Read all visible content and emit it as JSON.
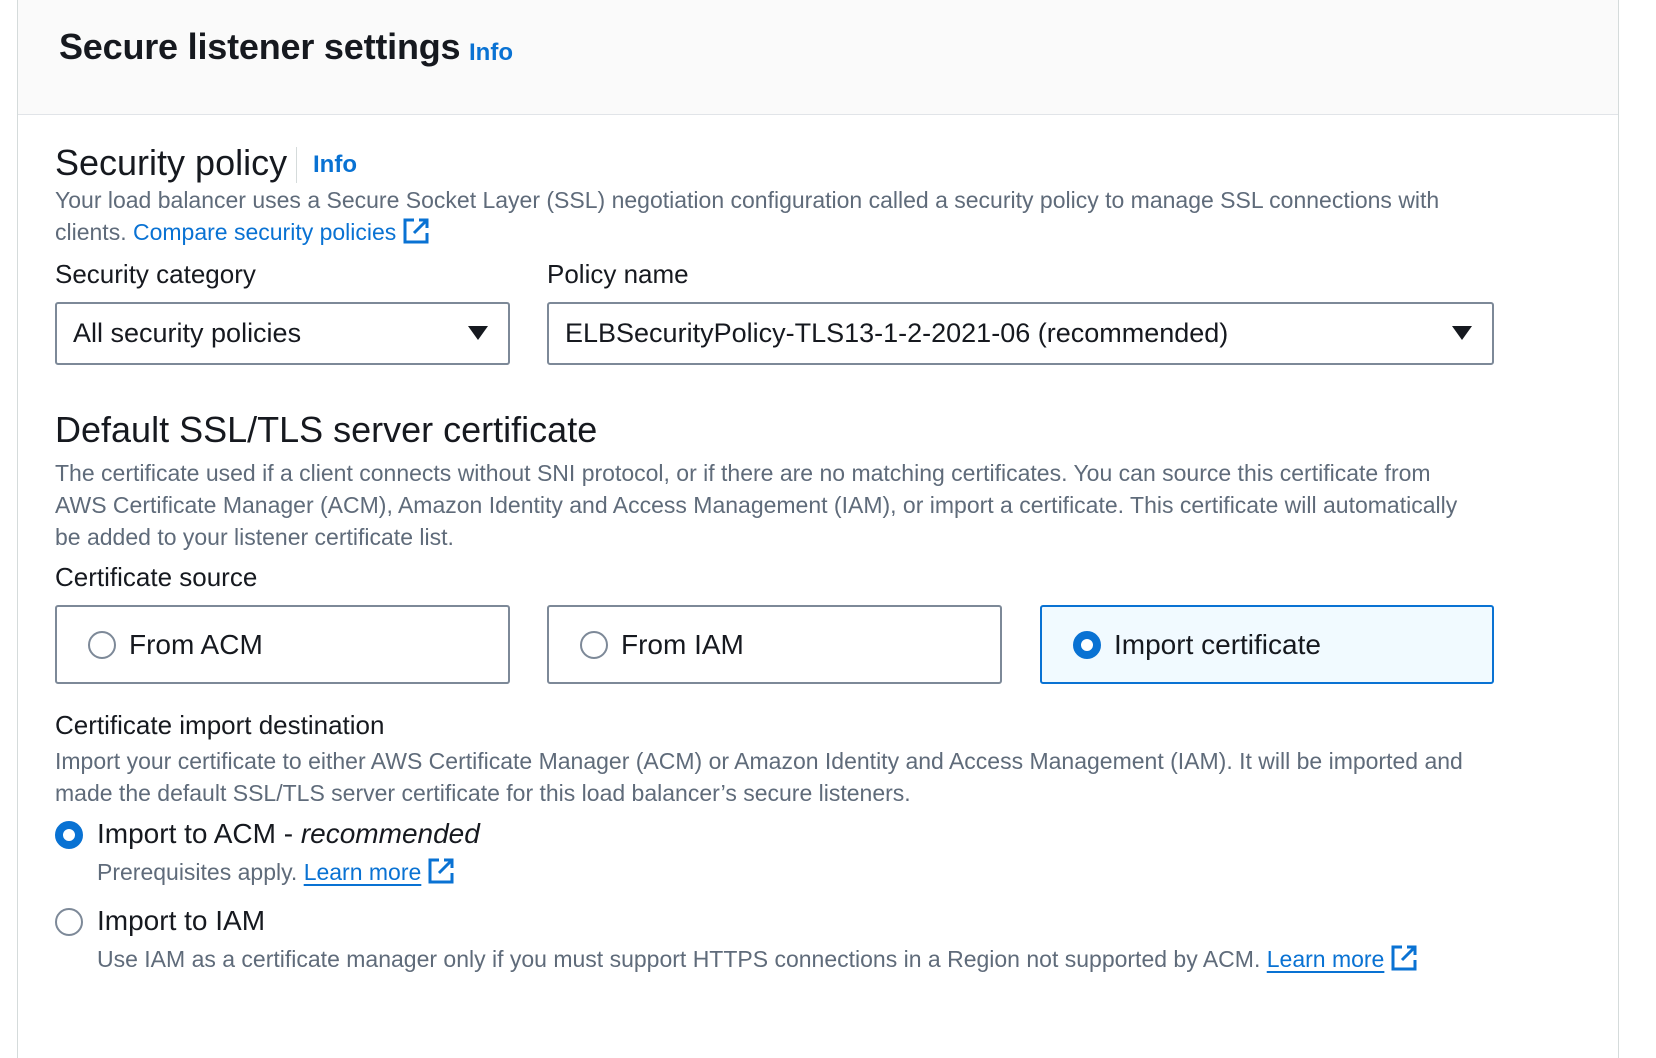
{
  "header": {
    "title": "Secure listener settings",
    "info": "Info"
  },
  "security_policy": {
    "title": "Security policy",
    "info": "Info",
    "description": "Your load balancer uses a Secure Socket Layer (SSL) negotiation configuration called a security policy to manage SSL connections with",
    "description_line2": "clients.",
    "compare_link": "Compare security policies",
    "category_label": "Security category",
    "category_value": "All security policies",
    "policy_label": "Policy name",
    "policy_value": "ELBSecurityPolicy-TLS13-1-2-2021-06 (recommended)"
  },
  "certificate": {
    "title": "Default SSL/TLS server certificate",
    "description_lines": [
      "The certificate used if a client connects without SNI protocol, or if there are no matching certificates. You can source this certificate from",
      "AWS Certificate Manager (ACM), Amazon Identity and Access Management (IAM), or import a certificate. This certificate will automatically",
      "be added to your listener certificate list."
    ],
    "source_label": "Certificate source",
    "sources": [
      {
        "label": "From ACM",
        "selected": false
      },
      {
        "label": "From IAM",
        "selected": false
      },
      {
        "label": "Import certificate",
        "selected": true
      }
    ]
  },
  "import_destination": {
    "title": "Certificate import destination",
    "description_lines": [
      "Import your certificate to either AWS Certificate Manager (ACM) or Amazon Identity and Access Management (IAM). It will be imported and",
      "made the default SSL/TLS server certificate for this load balancer’s secure listeners."
    ],
    "options": [
      {
        "label": "Import to ACM - ",
        "label_emphasis": "recommended",
        "selected": true,
        "description": "Prerequisites apply.",
        "link": "Learn more"
      },
      {
        "label": "Import to IAM",
        "selected": false,
        "description": "Use IAM as a certificate manager only if you must support HTTPS connections in a Region not supported by ACM.",
        "link": "Learn more"
      }
    ]
  },
  "colors": {
    "link": "#0972d3",
    "text": "#16191f",
    "secondary_text": "#5f6b7a",
    "border": "#7d8998",
    "selected_bg": "#f1faff"
  },
  "icons": [
    "external-link-icon",
    "caret-down-icon",
    "radio-icon"
  ]
}
